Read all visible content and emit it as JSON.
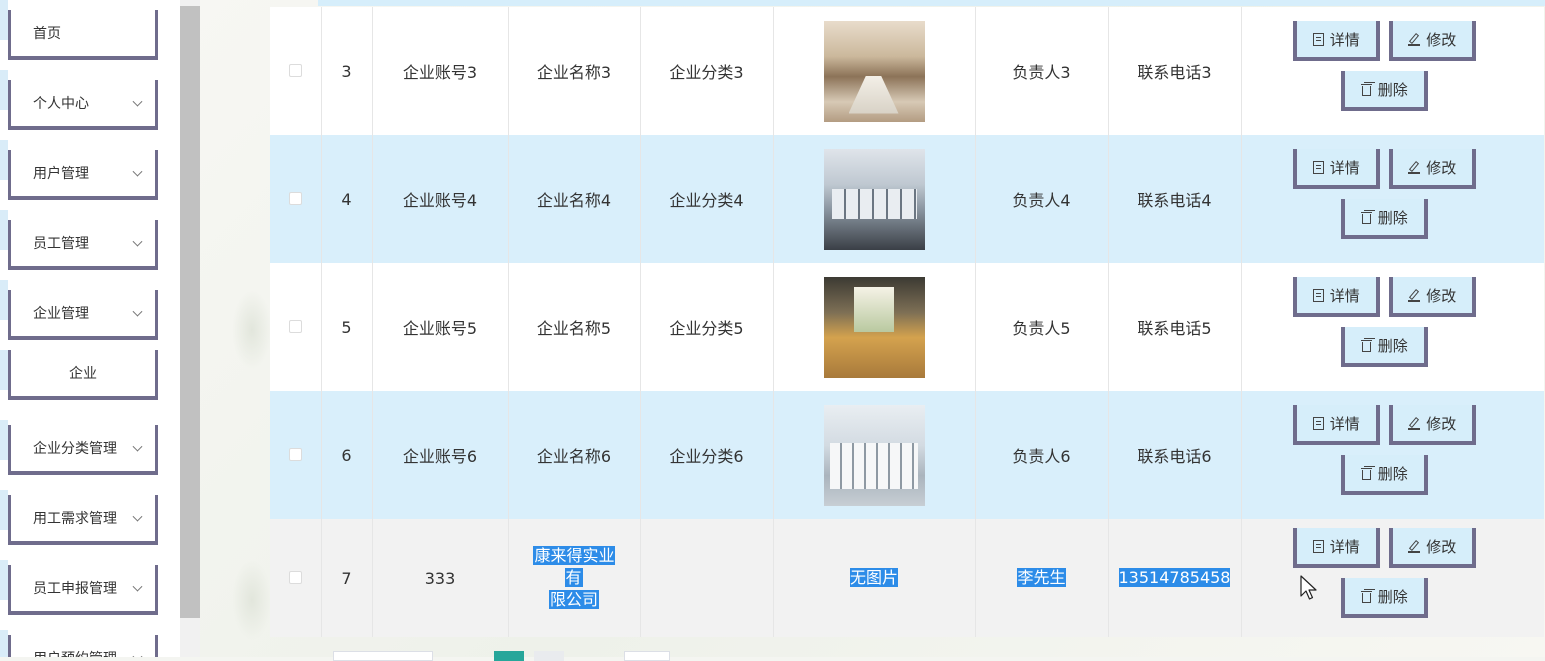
{
  "sidebar": {
    "items": [
      {
        "label": "首页",
        "has_arrow": false
      },
      {
        "label": "个人中心",
        "has_arrow": true
      },
      {
        "label": "用户管理",
        "has_arrow": true
      },
      {
        "label": "员工管理",
        "has_arrow": true
      },
      {
        "label": "企业管理",
        "has_arrow": true
      },
      {
        "label": "企业",
        "has_arrow": false
      },
      {
        "label": "企业分类管理",
        "has_arrow": true
      },
      {
        "label": "用工需求管理",
        "has_arrow": true
      },
      {
        "label": "员工申报管理",
        "has_arrow": true
      },
      {
        "label": "用户预约管理",
        "has_arrow": true
      }
    ]
  },
  "table": {
    "actions": {
      "detail": "详情",
      "edit": "修改",
      "delete": "删除"
    },
    "rows": [
      {
        "index": "3",
        "account": "企业账号3",
        "name": "企业名称3",
        "category": "企业分类3",
        "photo": "conference-room",
        "manager": "负责人3",
        "phone": "联系电话3"
      },
      {
        "index": "4",
        "account": "企业账号4",
        "name": "企业名称4",
        "category": "企业分类4",
        "photo": "office-cubicles",
        "manager": "负责人4",
        "phone": "联系电话4"
      },
      {
        "index": "5",
        "account": "企业账号5",
        "name": "企业名称5",
        "category": "企业分类5",
        "photo": "lounge-area",
        "manager": "负责人5",
        "phone": "联系电话5"
      },
      {
        "index": "6",
        "account": "企业账号6",
        "name": "企业名称6",
        "category": "企业分类6",
        "photo": "open-office",
        "manager": "负责人6",
        "phone": "联系电话6"
      },
      {
        "index": "7",
        "account": "333",
        "name_line1": "康来得实业有",
        "name_line2": "限公司",
        "category": "",
        "no_image": "无图片",
        "manager": "李先生",
        "phone": "13514785458"
      }
    ]
  },
  "colors": {
    "row_blue": "#d9effb",
    "button_bg": "#d6eefa",
    "button_border": "#6f6c8c",
    "selection": "#2d8ce8",
    "pager_active": "#26a69a"
  }
}
